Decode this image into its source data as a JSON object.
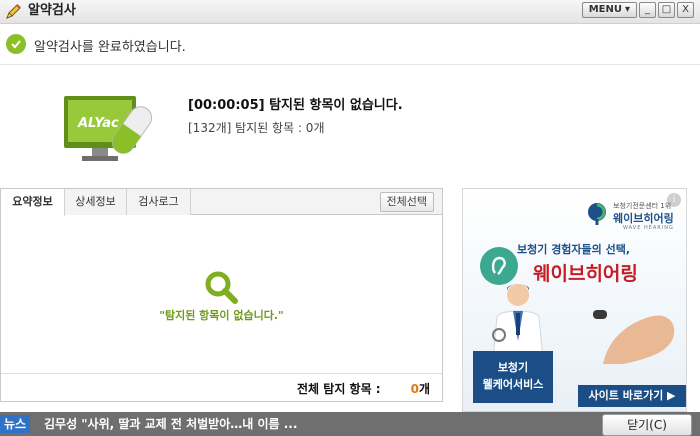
{
  "window": {
    "title": "알약검사",
    "menu_label": "MENU",
    "minimize_glyph": "_",
    "maximize_glyph": "□",
    "close_glyph": "X"
  },
  "status": {
    "message": "알약검사를 완료하였습니다."
  },
  "result": {
    "logo_text": "ALYac",
    "title": "[00:00:05]  탐지된 항목이 없습니다.",
    "summary": "[132개] 탐지된 항목 : 0개"
  },
  "panel": {
    "tabs": [
      {
        "label": "요약정보",
        "active": true
      },
      {
        "label": "상세정보",
        "active": false
      },
      {
        "label": "검사로그",
        "active": false
      }
    ],
    "select_all_label": "전체선택",
    "empty_message": "\"탐지된 항목이 없습니다.\"",
    "total_label": "전체 탐지 항목 :",
    "total_count": "0",
    "total_unit": "개"
  },
  "ad": {
    "brand_small": "보청기전문센터 1위",
    "brand_name": "웨이브히어링",
    "brand_en": "WAVE HEARING",
    "headline1": "보청기 경험자들의 선택,",
    "headline2": "웨이브히어링",
    "badge_line1": "보청기",
    "badge_line2": "웰케어서비스",
    "cta_label": "사이트 바로가기 ▶"
  },
  "news": {
    "label": "뉴스",
    "headline": "김무성 \"사위, 딸과 교제 전 처벌받아…내 이름 ...",
    "close_label": "닫기(C)"
  },
  "colors": {
    "accent_green": "#8bbf2a",
    "count_orange": "#e07a12",
    "news_blue": "#2f73c9",
    "ad_navy": "#1b4e86",
    "ad_red": "#c51d26"
  }
}
